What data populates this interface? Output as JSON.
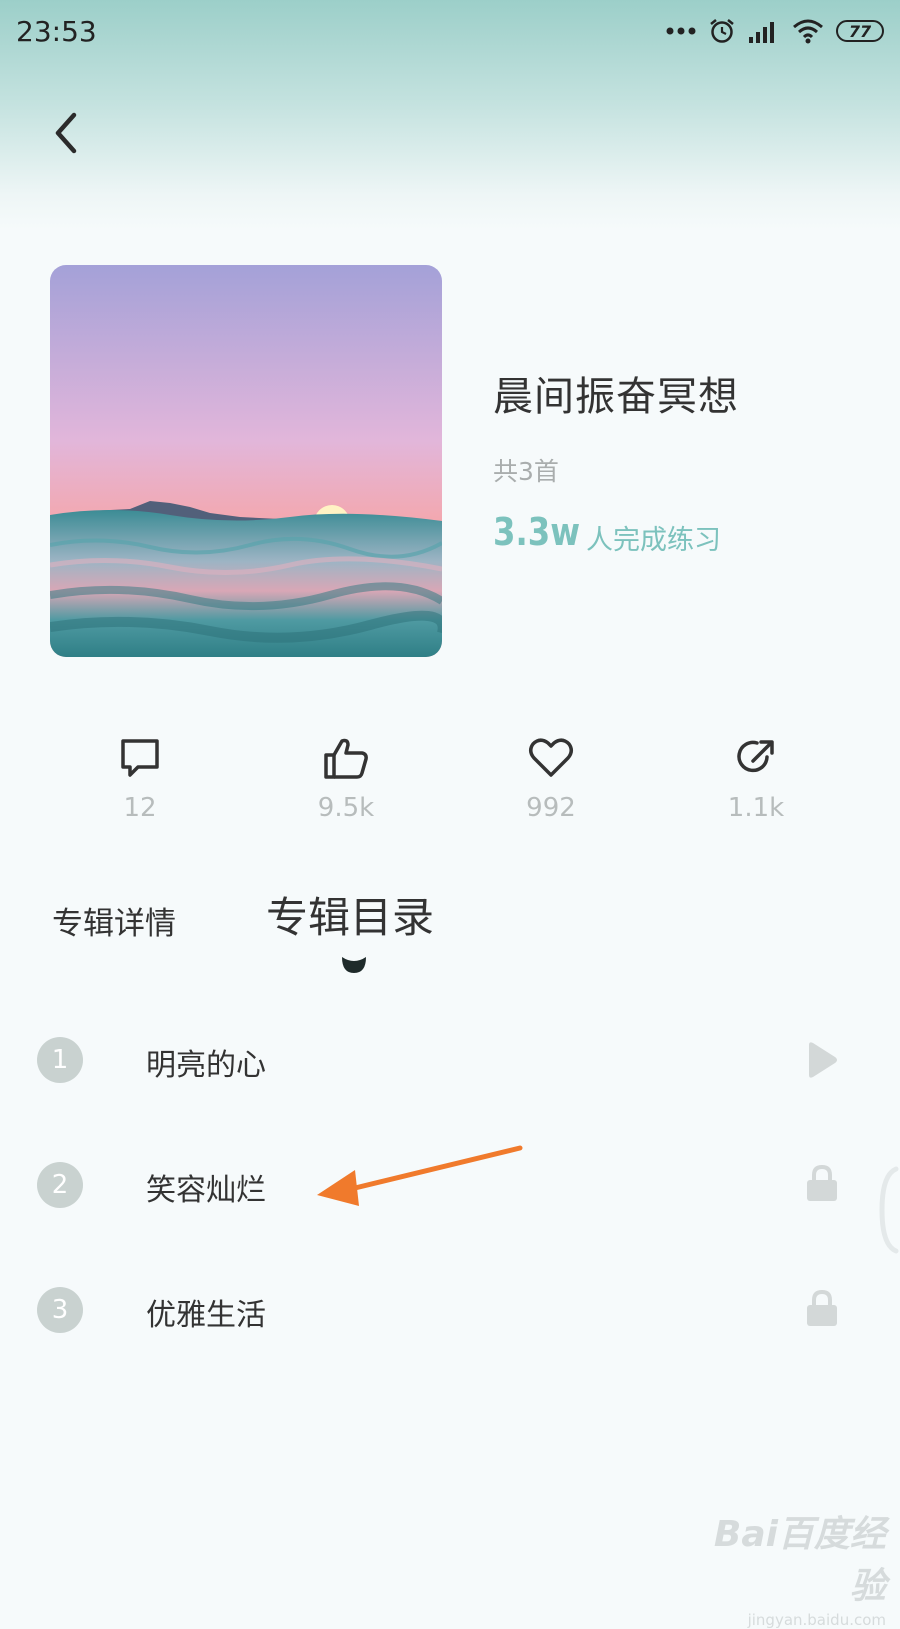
{
  "status_bar": {
    "time": "23:53",
    "battery": "77",
    "icons": [
      "more-dots-icon",
      "alarm-icon",
      "signal-icon",
      "wifi-icon",
      "battery-icon"
    ]
  },
  "header": {
    "back_icon": "chevron-left-icon"
  },
  "album": {
    "title": "晨间振奋冥想",
    "track_count": "共3首",
    "practice_count": "3.3w",
    "practice_label": "人完成练习"
  },
  "actions": {
    "comments": {
      "icon": "comment-icon",
      "count": "12"
    },
    "likes": {
      "icon": "thumbs-up-icon",
      "count": "9.5k"
    },
    "favorites": {
      "icon": "heart-icon",
      "count": "992"
    },
    "shares": {
      "icon": "share-icon",
      "count": "1.1k"
    }
  },
  "tabs": {
    "details": "专辑详情",
    "catalog": "专辑目录",
    "active": "catalog"
  },
  "tracks": [
    {
      "number": "1",
      "name": "明亮的心",
      "status": "play-icon"
    },
    {
      "number": "2",
      "name": "笑容灿烂",
      "status": "lock-icon"
    },
    {
      "number": "3",
      "name": "优雅生活",
      "status": "lock-icon"
    }
  ],
  "colors": {
    "accent": "#7cc2bd",
    "header_top": "#9ccfc9",
    "background": "#f6fafb",
    "annotation_arrow": "#f07a2c"
  },
  "watermark": {
    "logo": "Bai百度经验",
    "url": "jingyan.baidu.com"
  }
}
